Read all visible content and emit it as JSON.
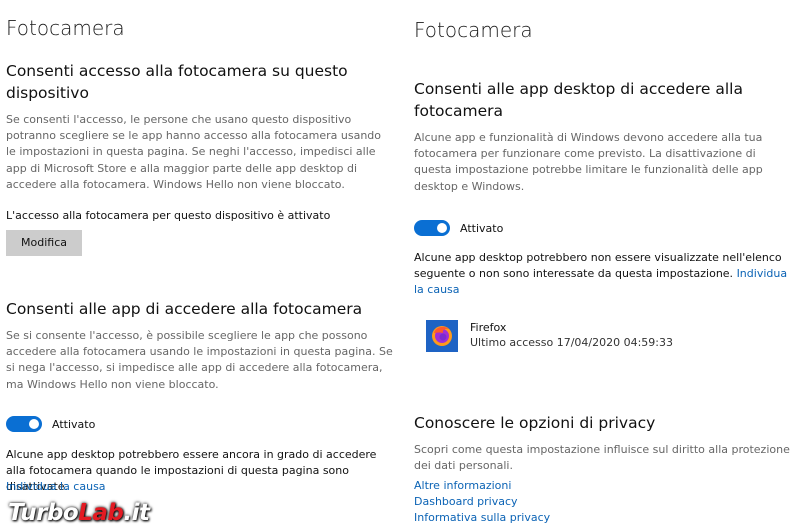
{
  "left": {
    "title": "Fotocamera",
    "device_section": {
      "title": "Consenti accesso alla fotocamera su questo dispositivo",
      "description": "Se consenti l'accesso, le persone che usano questo dispositivo potranno scegliere se le app hanno accesso alla fotocamera usando le impostazioni in questa pagina. Se neghi l'accesso, impedisci alle app di Microsoft Store e alla maggior parte delle app desktop di accedere alla fotocamera. Windows Hello non viene bloccato.",
      "status": "L'accesso alla fotocamera per questo dispositivo è attivato",
      "button_label": "Modifica"
    },
    "apps_section": {
      "title": "Consenti alle app di accedere alla fotocamera",
      "description": "Se si consente l'accesso, è possibile scegliere le app che possono accedere alla fotocamera usando le impostazioni in questa pagina. Se si nega l'accesso, si impedisce alle app di accedere alla fotocamera, ma Windows Hello non viene bloccato.",
      "toggle_state": true,
      "toggle_label": "Attivato",
      "note": "Alcune app desktop potrebbero essere ancora in grado di accedere alla fotocamera quando le impostazioni di questa pagina sono disattivate.",
      "link": "Individua la causa"
    }
  },
  "right": {
    "title": "Fotocamera",
    "desktop_section": {
      "title": "Consenti alle app desktop di accedere alla fotocamera",
      "description": "Alcune app e funzionalità di Windows devono accedere alla tua fotocamera per funzionare come previsto. La disattivazione di questa impostazione potrebbe limitare le funzionalità delle app desktop e Windows.",
      "toggle_state": true,
      "toggle_label": "Attivato",
      "note": "Alcune app desktop potrebbero non essere visualizzate nell'elenco seguente o non sono interessate da questa impostazione.",
      "link": "Individua la causa",
      "apps": [
        {
          "name": "Firefox",
          "last_access": "Ultimo accesso 17/04/2020 04:59:33",
          "icon": "firefox-icon"
        }
      ]
    },
    "privacy_section": {
      "title": "Conoscere le opzioni di privacy",
      "description": "Scopri come questa impostazione influisce sul diritto alla protezione dei dati personali.",
      "links": [
        "Altre informazioni",
        "Dashboard privacy",
        "Informativa sulla privacy"
      ]
    }
  },
  "watermark": {
    "part1": "Turbo",
    "part2": "Lab",
    "part3": ".it"
  },
  "colors": {
    "accent": "#0a6fd3",
    "link": "#0b63b5",
    "button_bg": "#cccccc"
  }
}
